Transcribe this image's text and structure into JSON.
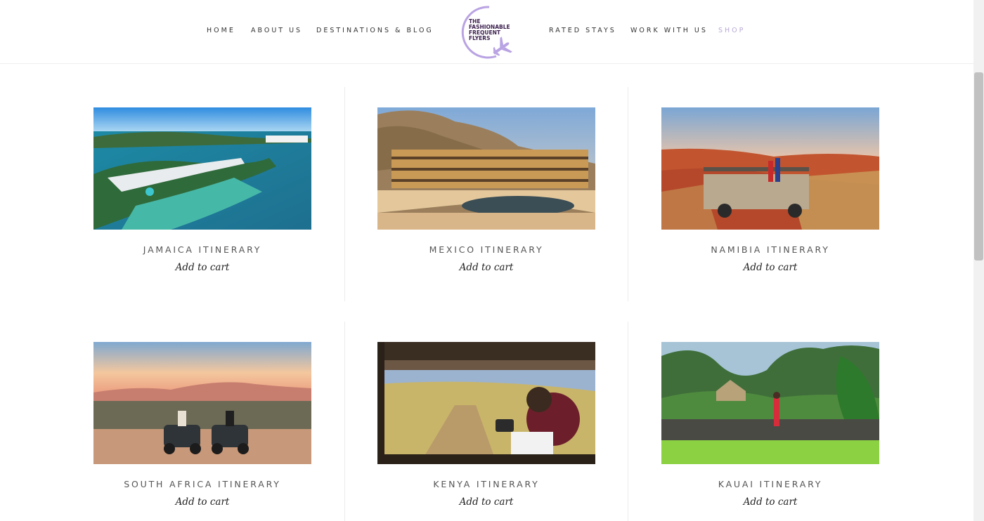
{
  "nav": {
    "left": [
      {
        "label": "HOME"
      },
      {
        "label": "ABOUT US"
      },
      {
        "label": "DESTINATIONS & BLOG"
      }
    ],
    "right": [
      {
        "label": "RATED STAYS"
      },
      {
        "label": "WORK WITH US"
      },
      {
        "label": "SHOP"
      }
    ]
  },
  "logo": {
    "lines": [
      "THE",
      "FASHIONABLE",
      "FREQUENT",
      "FLYERS"
    ],
    "color": "#b9a3e3",
    "text_color": "#3b1f4e"
  },
  "products": [
    {
      "title": "JAMAICA ITINERARY",
      "cart": "Add to cart",
      "image": "aerial-resort-lagoon"
    },
    {
      "title": "MEXICO ITINERARY",
      "cart": "Add to cart",
      "image": "cliffside-hotel-pool"
    },
    {
      "title": "NAMIBIA ITINERARY",
      "cart": "Add to cart",
      "image": "safari-truck-desert"
    },
    {
      "title": "SOUTH AFRICA ITINERARY",
      "cart": "Add to cart",
      "image": "quad-bikes-sunset"
    },
    {
      "title": "KENYA ITINERARY",
      "cart": "Add to cart",
      "image": "safari-vehicle-photographer"
    },
    {
      "title": "KAUAI ITINERARY",
      "cart": "Add to cart",
      "image": "tropical-garden-hut"
    }
  ],
  "colors": {
    "active_nav": "#b9a9d6",
    "accent": "#b9a3e3"
  }
}
